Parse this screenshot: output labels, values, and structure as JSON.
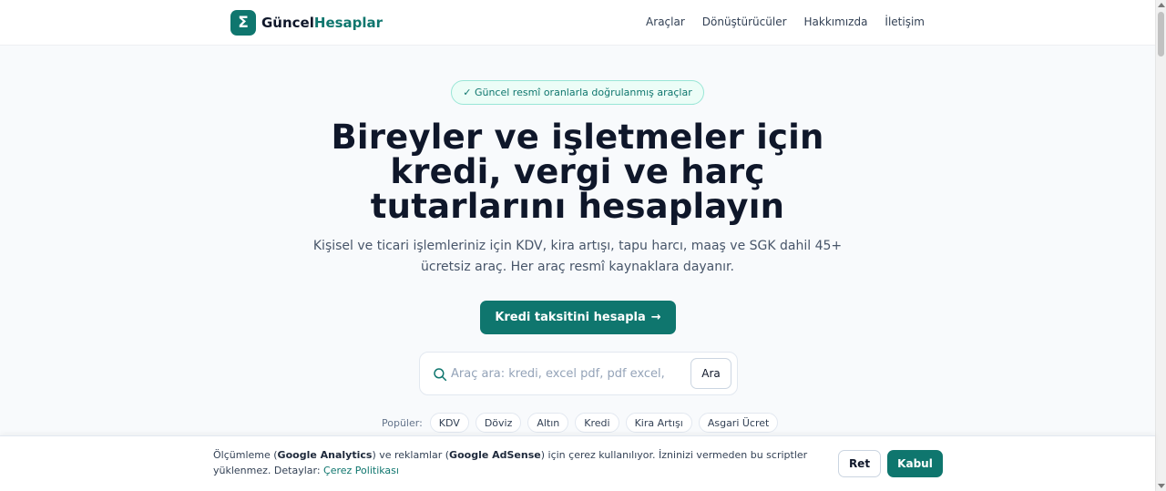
{
  "brand": {
    "logo_symbol": "Σ",
    "name_part1": "Güncel",
    "name_part2": "Hesaplar",
    "accent_color": "#0f766e"
  },
  "nav": {
    "items": [
      "Araçlar",
      "Dönüştürücüler",
      "Hakkımızda",
      "İletişim"
    ]
  },
  "hero": {
    "badge": "✓ Güncel resmî oranlarla doğrulanmış araçlar",
    "title": "Bireyler ve işletmeler için kredi, vergi ve harç tutarlarını hesaplayın",
    "subtitle": "Kişisel ve ticari işlemleriniz için KDV, kira artışı, tapu harcı, maaş ve SGK dahil 45+ ücretsiz araç. Her araç resmî kaynaklara dayanır.",
    "cta_label": "Kredi taksitini hesapla",
    "cta_arrow": "→"
  },
  "search": {
    "placeholder": "Araç ara: kredi, excel pdf, pdf excel,",
    "value": "",
    "button_label": "Ara",
    "icon": "search-icon"
  },
  "popular": {
    "label": "Popüler:",
    "chips": [
      "KDV",
      "Döviz",
      "Altın",
      "Kredi",
      "Kira Artışı",
      "Asgari Ücret"
    ]
  },
  "cookie": {
    "text_1": "Ölçümleme (",
    "bold_1": "Google Analytics",
    "text_2": ") ve reklamlar (",
    "bold_2": "Google AdSense",
    "text_3": ") için çerez kullanılıyor. İzninizi vermeden bu scriptler yüklenmez. Detaylar: ",
    "link": "Çerez Politikası",
    "reject_label": "Ret",
    "accept_label": "Kabul"
  }
}
